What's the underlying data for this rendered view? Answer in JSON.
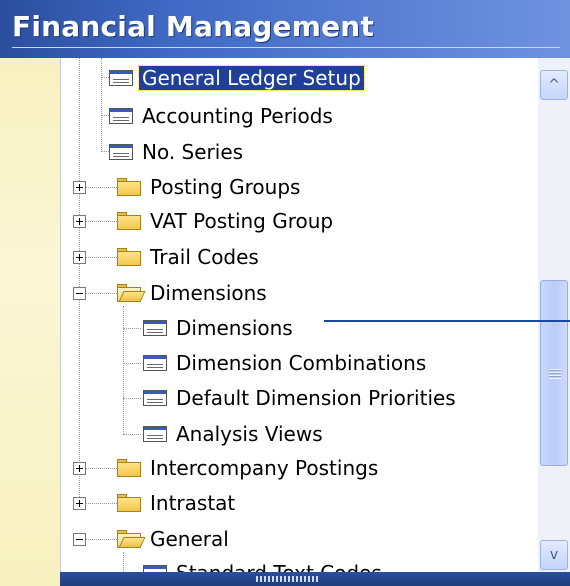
{
  "header": {
    "title": "Financial Management"
  },
  "tree": {
    "items": [
      {
        "label": "General Ledger Setup",
        "type": "form",
        "selected": true
      },
      {
        "label": "Accounting Periods",
        "type": "form"
      },
      {
        "label": "No. Series",
        "type": "form"
      },
      {
        "label": "Posting Groups",
        "type": "folder",
        "expanded": false
      },
      {
        "label": "VAT Posting Group",
        "type": "folder",
        "expanded": false
      },
      {
        "label": "Trail Codes",
        "type": "folder",
        "expanded": false
      },
      {
        "label": "Dimensions",
        "type": "folder",
        "expanded": true
      },
      {
        "label": "Dimensions",
        "type": "form"
      },
      {
        "label": "Dimension Combinations",
        "type": "form"
      },
      {
        "label": "Default Dimension Priorities",
        "type": "form"
      },
      {
        "label": "Analysis Views",
        "type": "form"
      },
      {
        "label": "Intercompany Postings",
        "type": "folder",
        "expanded": false
      },
      {
        "label": "Intrastat",
        "type": "folder",
        "expanded": false
      },
      {
        "label": "General",
        "type": "folder",
        "expanded": true
      },
      {
        "label": "Standard Text Codes",
        "type": "form"
      }
    ]
  },
  "scrollbar": {
    "up_icon": "^",
    "down_icon": "v"
  },
  "colors": {
    "header": "#2b4f9e",
    "selection": "#1f3f9a",
    "callout": "#1a4aa0"
  }
}
